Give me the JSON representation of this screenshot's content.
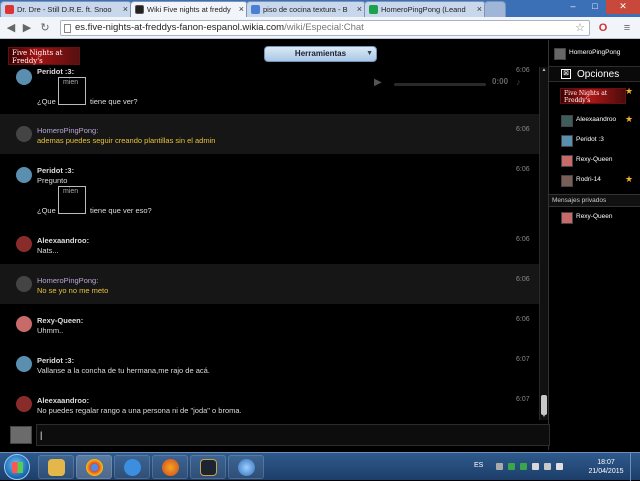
{
  "browser": {
    "tabs": [
      {
        "title": "Dr. Dre - Still D.R.E. ft. Snoo",
        "favicon_color": "#d33"
      },
      {
        "title": "Wiki Five nights at freddy",
        "favicon_color": "#222"
      },
      {
        "title": "piso de cocina textura - B",
        "favicon_color": "#4a7fd6"
      },
      {
        "title": "HomeroPingPong (Leand",
        "favicon_color": "#1aa34a"
      }
    ],
    "url_host": "es.five-nights-at-freddys-fanon-espanol.wikia.com",
    "url_path": "/wiki/Especial:Chat"
  },
  "header": {
    "logo_text": "Five Nights at Freddy's",
    "tools_label": "Herramientas"
  },
  "messages": [
    {
      "user": "Peridot :3",
      "lines": [
        "¿Que",
        "tiene que ver?"
      ],
      "time": "6:06",
      "image_alt": "mien",
      "me": false,
      "alt": false
    },
    {
      "user": "HomeroPingPong",
      "lines": [
        "ademas puedes seguir creando plantillas sin el admin"
      ],
      "time": "6:06",
      "me": true,
      "alt": true
    },
    {
      "user": "Peridot :3",
      "lines": [
        "Pregunto",
        "¿Que",
        "tiene que ver eso?"
      ],
      "time": "6:06",
      "image_alt": "mien",
      "me": false,
      "alt": false
    },
    {
      "user": "Aleexaandroo",
      "lines": [
        "Nats..."
      ],
      "time": "6:06",
      "me": false,
      "alt": false
    },
    {
      "user": "HomeroPingPong",
      "lines": [
        "No se yo no me meto"
      ],
      "time": "6:06",
      "me": true,
      "alt": true
    },
    {
      "user": "Rexy-Queen",
      "lines": [
        "Uhmm.."
      ],
      "time": "6:06",
      "me": false,
      "alt": false
    },
    {
      "user": "Peridot :3",
      "lines": [
        "Vallanse a la concha de tu hermana,me rajo de acá."
      ],
      "time": "6:07",
      "me": false,
      "alt": false
    },
    {
      "user": "Aleexaandroo",
      "lines": [
        "No puedes regalar rango a una persona ni de \"joda\" o broma."
      ],
      "time": "6:07",
      "me": false,
      "alt": false
    }
  ],
  "audio": {
    "time": "0:00"
  },
  "sidebar": {
    "self_name": "HomeroPingPong",
    "options_label": "Opciones",
    "logo_text": "Five Nights at Freddy's",
    "users": [
      {
        "name": "Aleexaandroo",
        "star": true
      },
      {
        "name": "Peridot :3",
        "star": false
      },
      {
        "name": "Rexy-Queen",
        "star": false
      },
      {
        "name": "Rodri-14",
        "star": true
      }
    ],
    "private_title": "Mensajes privados",
    "private_users": [
      {
        "name": "Rexy-Queen"
      }
    ]
  },
  "input": {
    "value": "|"
  },
  "taskbar": {
    "lang": "ES",
    "time": "18:07",
    "date": "21/04/2015"
  }
}
